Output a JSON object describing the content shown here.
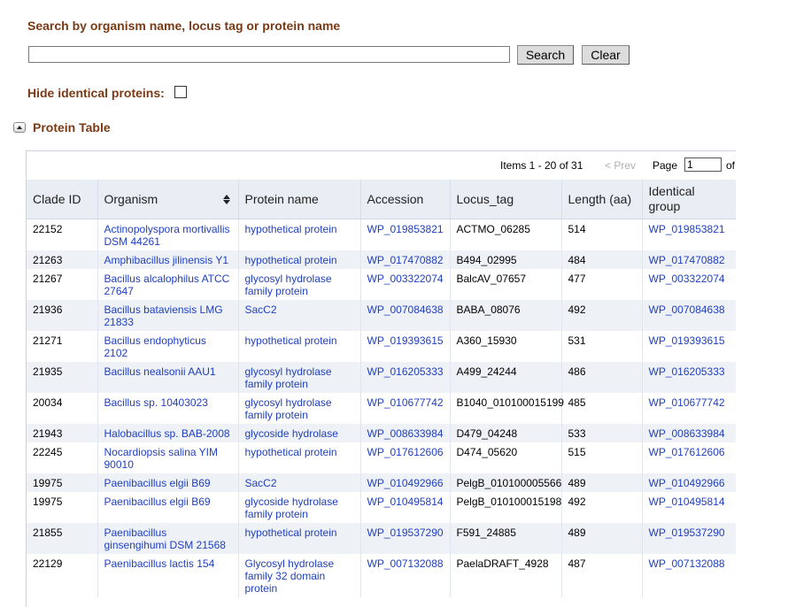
{
  "search": {
    "title": "Search by organism name, locus tag or protein name",
    "value": "",
    "search_label": "Search",
    "clear_label": "Clear"
  },
  "hide_identical": {
    "label": "Hide identical proteins:",
    "checked": false
  },
  "section": {
    "title": "Protein Table",
    "toggle_icon": "collapse-up-icon"
  },
  "pager": {
    "items_text": "Items 1 - 20 of 31",
    "prev_label": "< Prev",
    "page_label": "Page",
    "page_value": "1",
    "of_label": "of"
  },
  "table": {
    "columns": [
      "Clade ID",
      "Organism",
      "Protein name",
      "Accession",
      "Locus_tag",
      "Length (aa)",
      "Identical group"
    ],
    "sorted_column": "Organism",
    "rows": [
      {
        "clade": "22152",
        "organism": "Actinopolyspora mortivallis DSM 44261",
        "protein": "hypothetical protein",
        "accession": "WP_019853821",
        "locus": "ACTMO_06285",
        "length": "514",
        "group": "WP_019853821"
      },
      {
        "clade": "21263",
        "organism": "Amphibacillus jilinensis Y1",
        "protein": "hypothetical protein",
        "accession": "WP_017470882",
        "locus": "B494_02995",
        "length": "484",
        "group": "WP_017470882"
      },
      {
        "clade": "21267",
        "organism": "Bacillus alcalophilus ATCC 27647",
        "protein": "glycosyl hydrolase family protein",
        "accession": "WP_003322074",
        "locus": "BalcAV_07657",
        "length": "477",
        "group": "WP_003322074"
      },
      {
        "clade": "21936",
        "organism": "Bacillus bataviensis LMG 21833",
        "protein": "SacC2",
        "accession": "WP_007084638",
        "locus": "BABA_08076",
        "length": "492",
        "group": "WP_007084638"
      },
      {
        "clade": "21271",
        "organism": "Bacillus endophyticus 2102",
        "protein": "hypothetical protein",
        "accession": "WP_019393615",
        "locus": "A360_15930",
        "length": "531",
        "group": "WP_019393615"
      },
      {
        "clade": "21935",
        "organism": "Bacillus nealsonii AAU1",
        "protein": "glycosyl hydrolase family protein",
        "accession": "WP_016205333",
        "locus": "A499_24244",
        "length": "486",
        "group": "WP_016205333"
      },
      {
        "clade": "20034",
        "organism": "Bacillus sp. 10403023",
        "protein": "glycosyl hydrolase family protein",
        "accession": "WP_010677742",
        "locus": "B1040_010100015199",
        "length": "485",
        "group": "WP_010677742"
      },
      {
        "clade": "21943",
        "organism": "Halobacillus sp. BAB-2008",
        "protein": "glycoside hydrolase",
        "accession": "WP_008633984",
        "locus": "D479_04248",
        "length": "533",
        "group": "WP_008633984"
      },
      {
        "clade": "22245",
        "organism": "Nocardiopsis salina YIM 90010",
        "protein": "hypothetical protein",
        "accession": "WP_017612606",
        "locus": "D474_05620",
        "length": "515",
        "group": "WP_017612606"
      },
      {
        "clade": "19975",
        "organism": "Paenibacillus elgii B69",
        "protein": "SacC2",
        "accession": "WP_010492966",
        "locus": "PelgB_010100005566",
        "length": "489",
        "group": "WP_010492966"
      },
      {
        "clade": "19975",
        "organism": "Paenibacillus elgii B69",
        "protein": "glycoside hydrolase family protein",
        "accession": "WP_010495814",
        "locus": "PelgB_010100015198",
        "length": "492",
        "group": "WP_010495814"
      },
      {
        "clade": "21855",
        "organism": "Paenibacillus ginsengihumi DSM 21568",
        "protein": "hypothetical protein",
        "accession": "WP_019537290",
        "locus": "F591_24885",
        "length": "489",
        "group": "WP_019537290"
      },
      {
        "clade": "22129",
        "organism": "Paenibacillus lactis 154",
        "protein": "Glycosyl hydrolase family 32 domain protein",
        "accession": "WP_007132088",
        "locus": "PaelaDRAFT_4928",
        "length": "487",
        "group": "WP_007132088"
      }
    ]
  },
  "colors": {
    "heading": "#7a3a16",
    "link": "#1f3fbf",
    "row_alt": "#eef2f7",
    "header_bg": "#e9eef5"
  }
}
